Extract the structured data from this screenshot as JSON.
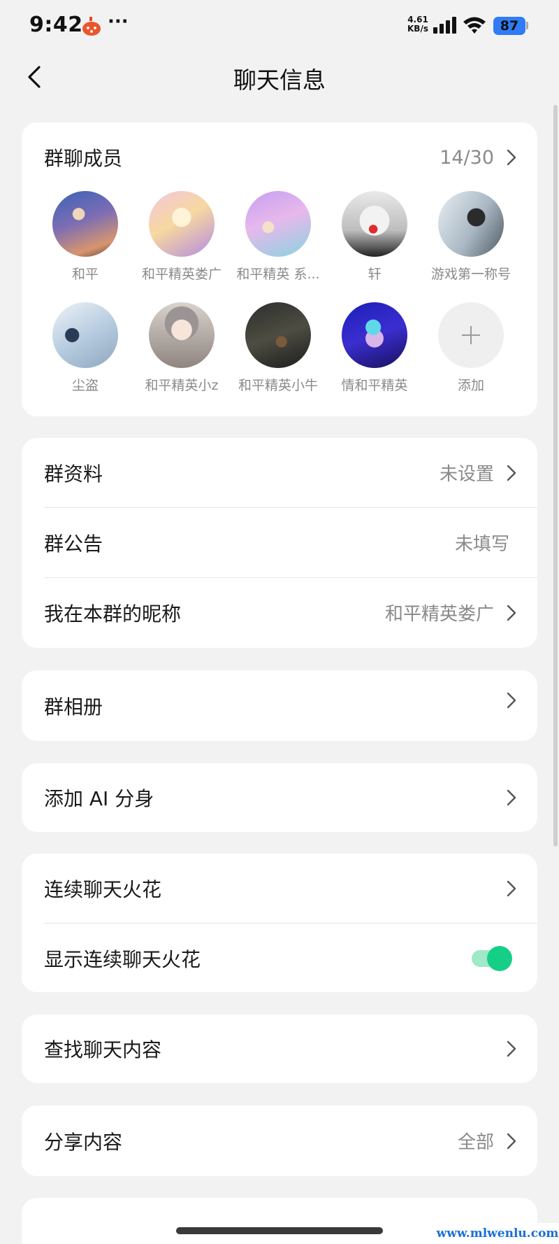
{
  "status_bar": {
    "time": "9:42",
    "more": "···",
    "net_speed_value": "4.61",
    "net_speed_unit": "KB/s",
    "battery": "87"
  },
  "header": {
    "title": "聊天信息"
  },
  "members_section": {
    "label": "群聊成员",
    "count": "14/30",
    "members": [
      {
        "name": "和平"
      },
      {
        "name": "和平精英娄广"
      },
      {
        "name": "和平精英 系..."
      },
      {
        "name": "轩"
      },
      {
        "name": "游戏第一称号"
      },
      {
        "name": "尘盗"
      },
      {
        "name": "和平精英小z"
      },
      {
        "name": "和平精英小牛"
      },
      {
        "name": "情和平精英"
      }
    ],
    "add_label": "添加"
  },
  "group_info": {
    "profile_label": "群资料",
    "profile_value": "未设置",
    "announcement_label": "群公告",
    "announcement_value": "未填写",
    "nickname_label": "我在本群的昵称",
    "nickname_value": "和平精英娄广"
  },
  "album": {
    "label": "群相册"
  },
  "ai_clone": {
    "label": "添加 AI 分身"
  },
  "streak": {
    "label": "连续聊天火花",
    "show_label": "显示连续聊天火花",
    "show_enabled": true
  },
  "search": {
    "label": "查找聊天内容"
  },
  "share": {
    "label": "分享内容",
    "value": "全部"
  },
  "watermark": "www.mlwenlu.com",
  "colors": {
    "background": "#f2f2f2",
    "card": "#ffffff",
    "toggle_on": "#16cf86",
    "battery": "#2f7cf6"
  }
}
